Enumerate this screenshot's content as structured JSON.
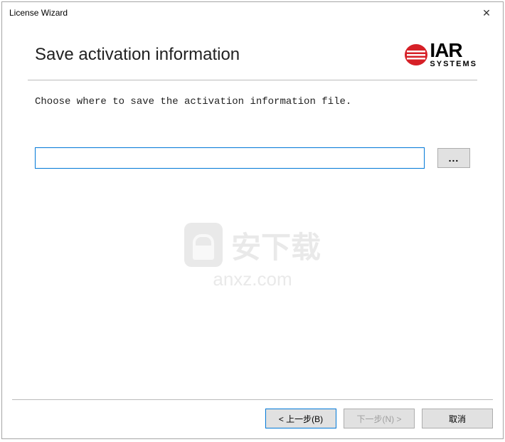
{
  "window": {
    "title": "License Wizard",
    "close_symbol": "✕"
  },
  "header": {
    "heading": "Save activation information",
    "logo": {
      "brand": "IAR",
      "subbrand": "SYSTEMS"
    }
  },
  "body": {
    "instruction": "Choose where to save the activation information file.",
    "path_value": "",
    "browse_label": "..."
  },
  "watermark": {
    "cn_text": "安下载",
    "url": "anxz.com"
  },
  "footer": {
    "back_label": "< 上一步(B)",
    "next_label": "下一步(N) >",
    "cancel_label": "取消"
  }
}
